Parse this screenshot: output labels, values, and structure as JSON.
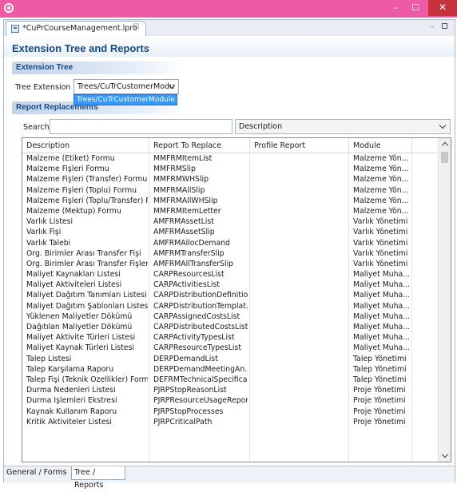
{
  "editor_tab": {
    "label": "*CuPrCourseManagement.lpro",
    "close": "☒"
  },
  "form_title": "Extension Tree and Reports",
  "extension_tree": {
    "section_title": "Extension Tree",
    "label": "Tree Extension",
    "selected": "Trees/CuTrCustomerModu",
    "dropdown_option": "Trees/CuTrCustomerModule.ltre"
  },
  "report_replacements": {
    "section_title": "Report Replacements",
    "search_label": "Search",
    "search_value": "",
    "search_column": "Description",
    "columns": [
      "Description",
      "Report To Replace",
      "Profile Report",
      "Module"
    ],
    "rows": [
      [
        "Malzeme (Etiket) Formu",
        "MMFRMItemList",
        "",
        "Malzeme Yön..."
      ],
      [
        "Malzeme Fişleri Formu",
        "MMFRMSlip",
        "",
        "Malzeme Yön..."
      ],
      [
        "Malzeme Fişleri (Transfer) Formu",
        "MMFRMWHSlip",
        "",
        "Malzeme Yön..."
      ],
      [
        "Malzeme Fişleri (Toplu) Formu",
        "MMFRMAllSlip",
        "",
        "Malzeme Yön..."
      ],
      [
        "Malzeme Fişleri (Toplu/Transfer) F...",
        "MMFRMAllWHSlip",
        "",
        "Malzeme Yön..."
      ],
      [
        "Malzeme (Mektup) Formu",
        "MMFRMItemLetter",
        "",
        "Malzeme Yön..."
      ],
      [
        "Varlık Listesi",
        "AMFRMAssetList",
        "",
        "Varlık Yönetimi"
      ],
      [
        "Varlık Fişi",
        "AMFRMAssetSlip",
        "",
        "Varlık Yönetimi"
      ],
      [
        "Varlık Talebi",
        "AMFRMAllocDemand",
        "",
        "Varlık Yönetimi"
      ],
      [
        "Org. Birimler Arası Transfer Fişi",
        "AMFRMTransferSlip",
        "",
        "Varlık Yönetimi"
      ],
      [
        "Org. Birimler Arası Transfer Fişleri",
        "AMFRMAllTransferSlip",
        "",
        "Varlık Yönetimi"
      ],
      [
        "Maliyet Kaynakları Listesi",
        "CARPResourcesList",
        "",
        "Maliyet Muha..."
      ],
      [
        "Maliyet Aktiviteleri Listesi",
        "CARPActivitiesList",
        "",
        "Maliyet Muha..."
      ],
      [
        "Maliyet Dağıtım Tanımları Listesi",
        "CARPDistributionDefinitio...",
        "",
        "Maliyet Muha..."
      ],
      [
        "Maliyet Dağıtım Şablonları Listesi",
        "CARPDistributionTemplat...",
        "",
        "Maliyet Muha..."
      ],
      [
        "Yüklenen Maliyetler Dökümü",
        "CARPAssignedCostsList",
        "",
        "Maliyet Muha..."
      ],
      [
        "Dağıtılan Maliyetler Dökümü",
        "CARPDistributedCostsList",
        "",
        "Maliyet Muha..."
      ],
      [
        "Maliyet Aktivite Türleri Listesi",
        "CARPActivityTypesList",
        "",
        "Maliyet Muha..."
      ],
      [
        "Maliyet Kaynak Türleri Listesi",
        "CARPResourceTypesList",
        "",
        "Maliyet Muha..."
      ],
      [
        "Talep Listesi",
        "DERPDemandList",
        "",
        "Talep Yönetimi"
      ],
      [
        "Talep Karşılama Raporu",
        "DERPDemandMeetingAn...",
        "",
        "Talep Yönetimi"
      ],
      [
        "Talep Fişi (Teknik Özellikler) Formu",
        "DEFRMTechnicalSpecifica...",
        "",
        "Talep Yönetimi"
      ],
      [
        "Durma Nedenleri Listesi",
        "PJRPStopReasonList",
        "",
        "Proje Yönetimi"
      ],
      [
        "Durma İşlemleri Ekstresi",
        "PJRPResourceUsageReport",
        "",
        "Proje Yönetimi"
      ],
      [
        "Kaynak Kullanım Raporu",
        "PJRPStopProcesses",
        "",
        "Proje Yönetimi"
      ],
      [
        "Kritik Aktiviteler Listesi",
        "PJRPCriticalPath",
        "",
        "Proje Yönetimi"
      ]
    ]
  },
  "bottom_tabs": [
    "General / Forms",
    "Tree / Reports"
  ],
  "window_controls": {
    "minimize": "–",
    "maximize": "☐",
    "close": "✕"
  },
  "colors": {
    "titlebar": "#ef5aa6",
    "close": "#c7313b",
    "section": "#c2d3ea",
    "title_text": "#1a4a82",
    "selection": "#3399ff"
  },
  "icons": [
    "app-icon",
    "file-icon",
    "chevron-down-icon",
    "scroll-up-icon",
    "scroll-down-icon"
  ]
}
